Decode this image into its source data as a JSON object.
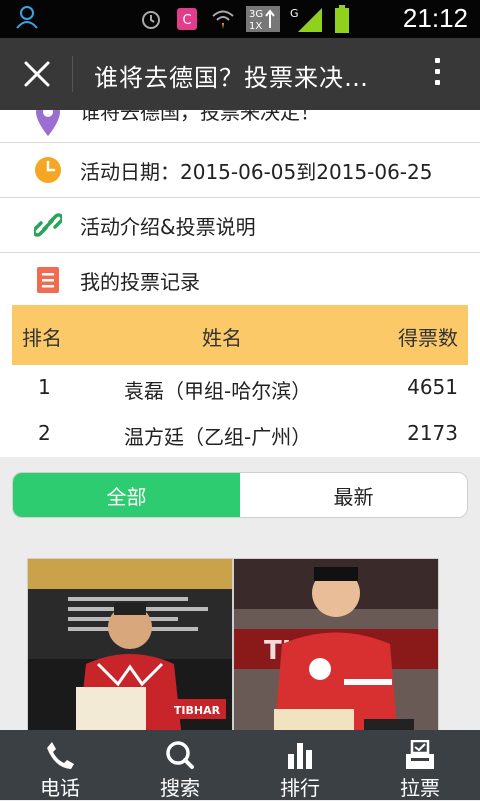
{
  "status_bar": {
    "time": "21:12",
    "network_label": "3G",
    "network_sub": "1X",
    "signal_label": "G"
  },
  "title_bar": {
    "title": "谁将去德国？投票来决…"
  },
  "info_rows": [
    {
      "icon": "location-pin-icon",
      "text": "谁将去德国，投票来决定！"
    },
    {
      "icon": "clock-icon",
      "text": "活动日期：2015-06-05到2015-06-25"
    },
    {
      "icon": "link-icon",
      "text": "活动介绍&投票说明"
    },
    {
      "icon": "list-icon",
      "text": "我的投票记录"
    }
  ],
  "ranking": {
    "headers": {
      "rank": "排名",
      "name": "姓名",
      "votes": "得票数"
    },
    "rows": [
      {
        "rank": "1",
        "name": "袁磊（甲组-哈尔滨）",
        "votes": "4651"
      },
      {
        "rank": "2",
        "name": "温方廷（乙组-广州）",
        "votes": "2173"
      }
    ]
  },
  "filter_tabs": {
    "all": "全部",
    "latest": "最新",
    "active": "all"
  },
  "photo_cards": [
    {
      "photo_text": "TIBHAR"
    },
    {
      "photo_text": "TIBHAR"
    }
  ],
  "bottom_tabs": [
    {
      "icon": "phone-icon",
      "label": "电话"
    },
    {
      "icon": "search-icon",
      "label": "搜索"
    },
    {
      "icon": "bar-chart-icon",
      "label": "排行"
    },
    {
      "icon": "vote-box-icon",
      "label": "拉票"
    }
  ],
  "colors": {
    "accent_green": "#2ecc71",
    "table_header": "#fcc969",
    "title_bar": "#383838",
    "tab_bar": "#3b4045",
    "clock_orange": "#f5a623",
    "link_green": "#27a35a",
    "list_orange": "#f06b4f",
    "pin_purple": "#9b6fd1"
  }
}
